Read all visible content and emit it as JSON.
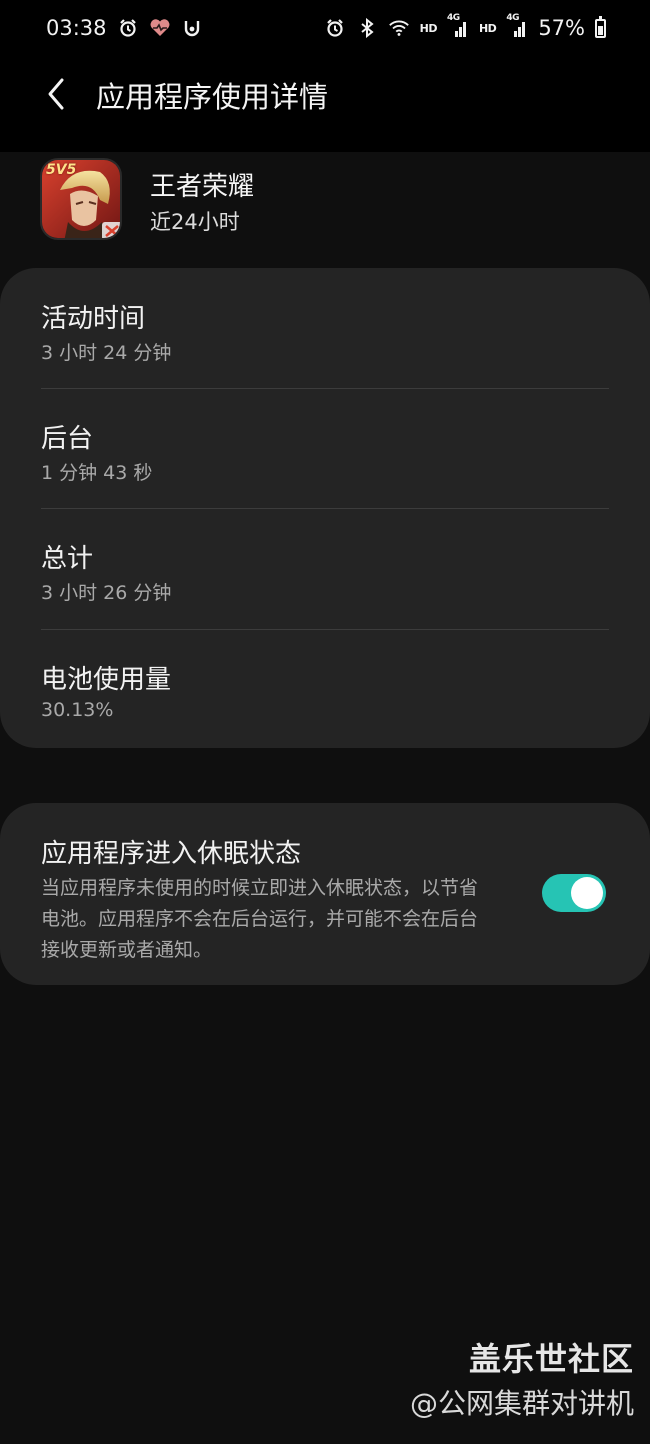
{
  "status_bar": {
    "time": "03:38",
    "battery_percent": "57%",
    "battery_level": 0.57,
    "network_labels": [
      "HD",
      "4G",
      "HD",
      "4G"
    ],
    "left_icons": [
      "alarm-icon",
      "heart-health-icon",
      "app-notification-icon"
    ],
    "right_icons": [
      "alarm-icon",
      "bluetooth-icon",
      "wifi-icon",
      "signal-icon",
      "signal-icon",
      "battery-icon"
    ]
  },
  "app_bar": {
    "back_icon": "chevron-left-icon",
    "title": "应用程序使用详情"
  },
  "app": {
    "name": "王者荣耀",
    "range": "近24小时",
    "icon_badge": "5V5"
  },
  "stats": [
    {
      "label": "活动时间",
      "value": "3 小时 24 分钟"
    },
    {
      "label": "后台",
      "value": "1 分钟 43 秒"
    },
    {
      "label": "总计",
      "value": "3 小时 26 分钟"
    },
    {
      "label": "电池使用量",
      "value": "30.13%"
    }
  ],
  "sleep": {
    "title": "应用程序进入休眠状态",
    "description": "当应用程序未使用的时候立即进入休眠状态，以节省电池。应用程序不会在后台运行，并可能不会在后台接收更新或者通知。",
    "toggle_on": true
  },
  "watermark": {
    "line1": "盖乐世社区",
    "line2": "@公网集群对讲机"
  },
  "colors": {
    "accent": "#26c4b4",
    "card": "#242424",
    "background": "#0f0f0f"
  }
}
